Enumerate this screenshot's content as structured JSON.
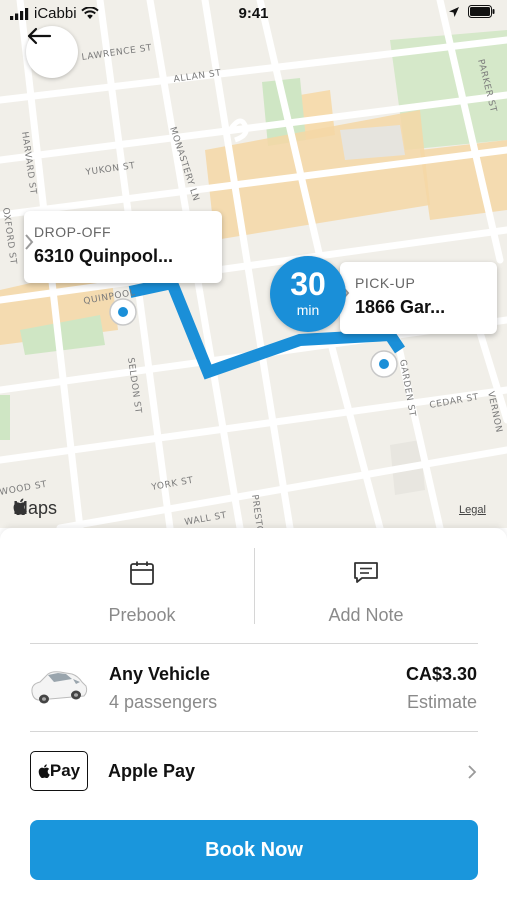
{
  "status_bar": {
    "carrier": "iCabbi",
    "time": "9:41"
  },
  "map": {
    "street_labels": [
      "LAWRENCE ST",
      "ALLAN ST",
      "PARKER ST",
      "HARVARD ST",
      "YUKON ST",
      "MONASTERY LN",
      "OXFORD ST",
      "QUINPOOL",
      "SELDON ST",
      "GARDEN ST",
      "CEDAR ST",
      "VERNON",
      "YORK ST",
      "WOOD ST",
      "WALL ST",
      "PRESTON"
    ],
    "attribution": "Maps",
    "legal": "Legal",
    "route_color": "#1a8fd8"
  },
  "dropoff": {
    "caption": "DROP-OFF",
    "address": "6310 Quinpool..."
  },
  "pickup": {
    "caption": "PICK-UP",
    "address": "1866 Gar..."
  },
  "eta": {
    "value": "30",
    "unit": "min"
  },
  "actions": {
    "prebook_label": "Prebook",
    "note_label": "Add Note"
  },
  "vehicle": {
    "name": "Any Vehicle",
    "capacity": "4 passengers",
    "price": "CA$3.30",
    "price_note": "Estimate"
  },
  "payment": {
    "badge": "Pay",
    "method": "Apple Pay"
  },
  "book_button": "Book Now",
  "colors": {
    "accent": "#1a96dc",
    "map_bg": "#f1efe9"
  }
}
